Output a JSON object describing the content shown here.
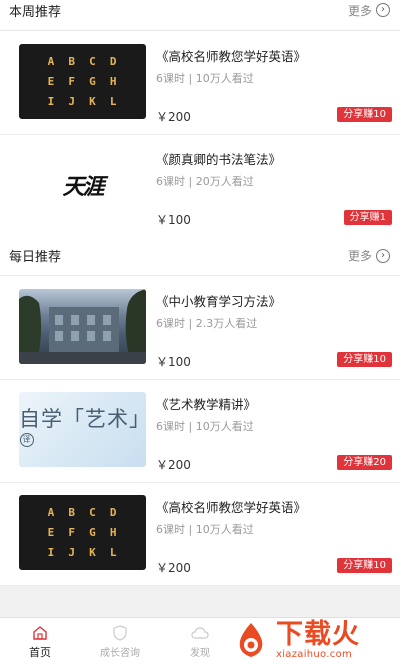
{
  "sections": {
    "weekly": {
      "title": "本周推荐",
      "more": "更多"
    },
    "daily": {
      "title": "每日推荐",
      "more": "更多"
    }
  },
  "courses": [
    {
      "title": "《高校名师教您学好英语》",
      "meta": "6课时 | 10万人看过",
      "price": "￥200",
      "share": "分享赚10",
      "thumb": "alphabet",
      "letters": [
        "A",
        "B",
        "C",
        "D",
        "E",
        "F",
        "G",
        "H",
        "I",
        "J",
        "K",
        "L"
      ]
    },
    {
      "title": "《颜真卿的书法笔法》",
      "meta": "6课时 | 20万人看过",
      "price": "￥100",
      "share": "分享赚1",
      "thumb": "calligraphy",
      "thumb_text": "天涯"
    },
    {
      "title": "《中小教育学习方法》",
      "meta": "6课时 | 2.3万人看过",
      "price": "￥100",
      "share": "分享赚10",
      "thumb": "photo"
    },
    {
      "title": "《艺术教学精讲》",
      "meta": "6课时 | 10万人看过",
      "price": "￥200",
      "share": "分享赚20",
      "thumb": "art",
      "thumb_text": "自学「艺术」",
      "thumb_badge": "译"
    },
    {
      "title": "《高校名师教您学好英语》",
      "meta": "6课时 | 10万人看过",
      "price": "￥200",
      "share": "分享赚10",
      "thumb": "alphabet",
      "letters": [
        "A",
        "B",
        "C",
        "D",
        "E",
        "F",
        "G",
        "H",
        "I",
        "J",
        "K",
        "L"
      ]
    }
  ],
  "tabs": [
    {
      "label": "首页",
      "icon": "home-icon",
      "active": true
    },
    {
      "label": "成长咨询",
      "icon": "shield-icon",
      "active": false
    },
    {
      "label": "发现",
      "icon": "cloud-icon",
      "active": false
    }
  ],
  "watermark": {
    "cn": "下载火",
    "en": "xiazaihuo.com"
  },
  "colors": {
    "accent": "#e0343a",
    "watermark": "#e94b23",
    "gap": "#f1f1f1"
  }
}
